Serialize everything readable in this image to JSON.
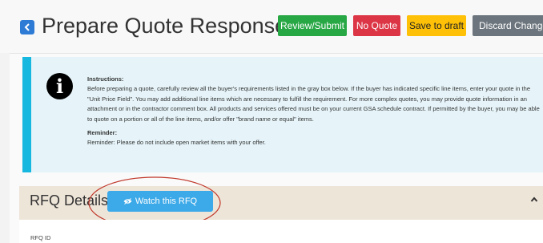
{
  "header": {
    "title": "Prepare Quote Response",
    "buttons": {
      "review_submit": "Review/Submit",
      "no_quote": "No Quote",
      "save_draft": "Save to draft",
      "discard": "Discard Changes"
    }
  },
  "instructions": {
    "heading": "Instructions:",
    "body": "Before preparing a quote, carefully review all the buyer's requirements listed in the gray box below. If the buyer has indicated specific line items, enter your quote in the \"Unit Price Field\". You may add additional line items which are necessary to fulfill the requirement. For more complex quotes, you may provide quote information in an attachment or in the contractor comment box. All products and services offered must be on your current GSA schedule contract. If permitted by the buyer, you may be able to quote on a portion or all of the line items, and/or offer \"brand name or equal\" items.",
    "reminder_heading": "Reminder:",
    "reminder_body": "Reminder: Please do not include open market items with your offer."
  },
  "rfq": {
    "title": "RFQ Details",
    "watch_label": "Watch this RFQ",
    "id_label": "RFQ ID"
  },
  "colors": {
    "review": "#28a745",
    "no_quote": "#dc3545",
    "draft": "#ffc107",
    "discard": "#6c757d",
    "watch": "#3ca9e8",
    "info_stripe": "#17b8e0",
    "annotation": "#c0392b"
  }
}
